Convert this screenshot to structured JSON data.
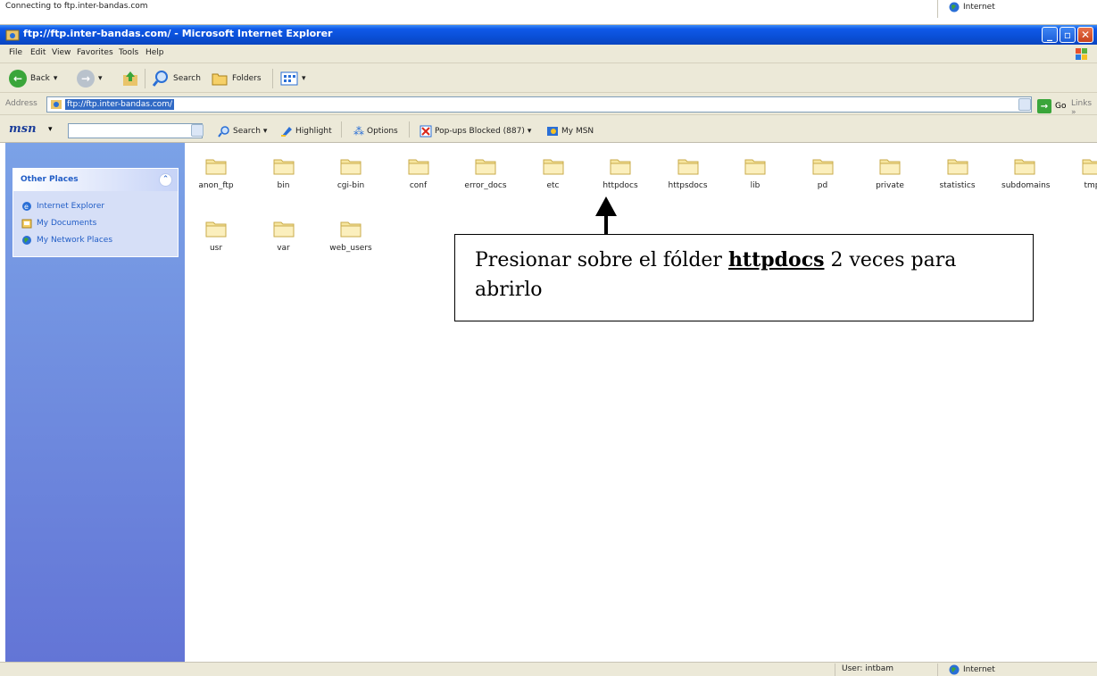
{
  "status_top": {
    "text": "Connecting to ftp.inter-bandas.com",
    "zone": "Internet"
  },
  "window": {
    "title": "ftp://ftp.inter-bandas.com/ - Microsoft Internet Explorer"
  },
  "menu": [
    "File",
    "Edit",
    "View",
    "Favorites",
    "Tools",
    "Help"
  ],
  "toolbar": {
    "back": "Back",
    "search": "Search",
    "folders": "Folders"
  },
  "address": {
    "label": "Address",
    "url": "ftp://ftp.inter-bandas.com/",
    "go": "Go",
    "links": "Links"
  },
  "msn": {
    "logo": "msn",
    "search": "Search",
    "highlight": "Highlight",
    "options": "Options",
    "popups": "Pop-ups Blocked (887)",
    "my_msn": "My MSN"
  },
  "sidebar": {
    "title": "Other Places",
    "places": [
      "Internet Explorer",
      "My Documents",
      "My Network Places"
    ]
  },
  "folders": [
    "anon_ftp",
    "bin",
    "cgi-bin",
    "conf",
    "error_docs",
    "etc",
    "httpdocs",
    "httpsdocs",
    "lib",
    "pd",
    "private",
    "statistics",
    "subdomains",
    "tmp",
    "usr",
    "var",
    "web_users"
  ],
  "callout": {
    "before": "Presionar sobre el fólder ",
    "bold": "httpdocs",
    "after": " 2 veces para abrirlo"
  },
  "status_bottom": {
    "user": "User: intbam",
    "zone": "Internet"
  },
  "colors": {
    "title_blue": "#0a4fd6",
    "sidebar_blue": "#7ba2e7",
    "folder_yellow": "#f6e6a0"
  }
}
